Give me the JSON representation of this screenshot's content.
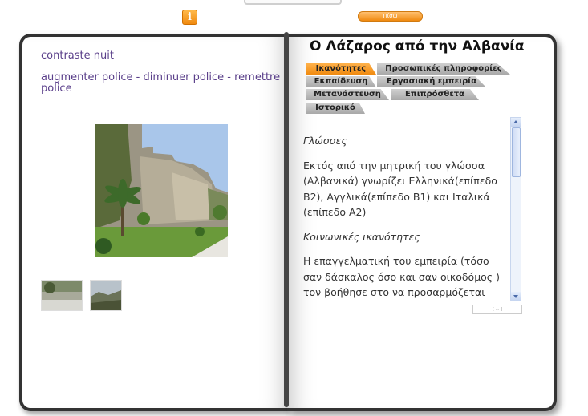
{
  "header": {
    "info_glyph": "i",
    "back_label": "Πίσω"
  },
  "left_page": {
    "contrast_link": "contraste nuit",
    "police_links": [
      "augmenter police",
      "diminuer police",
      "remettre police"
    ],
    "police_separator": " - "
  },
  "right_page": {
    "title": "Ο Λάζαρος από την Αλβανία",
    "tabs": [
      {
        "label": "Ικανότητες",
        "active": true
      },
      {
        "label": "Προσωπικές πληροφορίες",
        "active": false
      },
      {
        "label": "Εκπαίδευση",
        "active": false
      },
      {
        "label": "Εργασιακή εμπειρία",
        "active": false
      },
      {
        "label": "Μετανάστευση",
        "active": false
      },
      {
        "label": "Επιπρόσθετα",
        "active": false
      },
      {
        "label": "Ιστορικό",
        "active": false
      }
    ],
    "content": {
      "heading1": "Γλώσσες",
      "para1": "Εκτός από την μητρική του γλώσσα (Αλβανικά) γνωρίζει Ελληνικά(επίπεδο Β2), Αγγλικά(επίπεδο Β1) και Ιταλικά (επίπεδο Α2)",
      "heading2": "Κοινωνικές ικανότητες",
      "para2": "Η επαγγελματική του εμπειρία (τόσο σαν δάσκαλος όσο και σαν οικοδόμος ) τον βοήθησε στο να προσαρμόζεται εύκολα σε"
    },
    "small_field": "[ ... ]"
  },
  "colors": {
    "accent": "#f08a10",
    "link": "#5a3f8a",
    "tab_inactive": "#b8b8b8"
  }
}
